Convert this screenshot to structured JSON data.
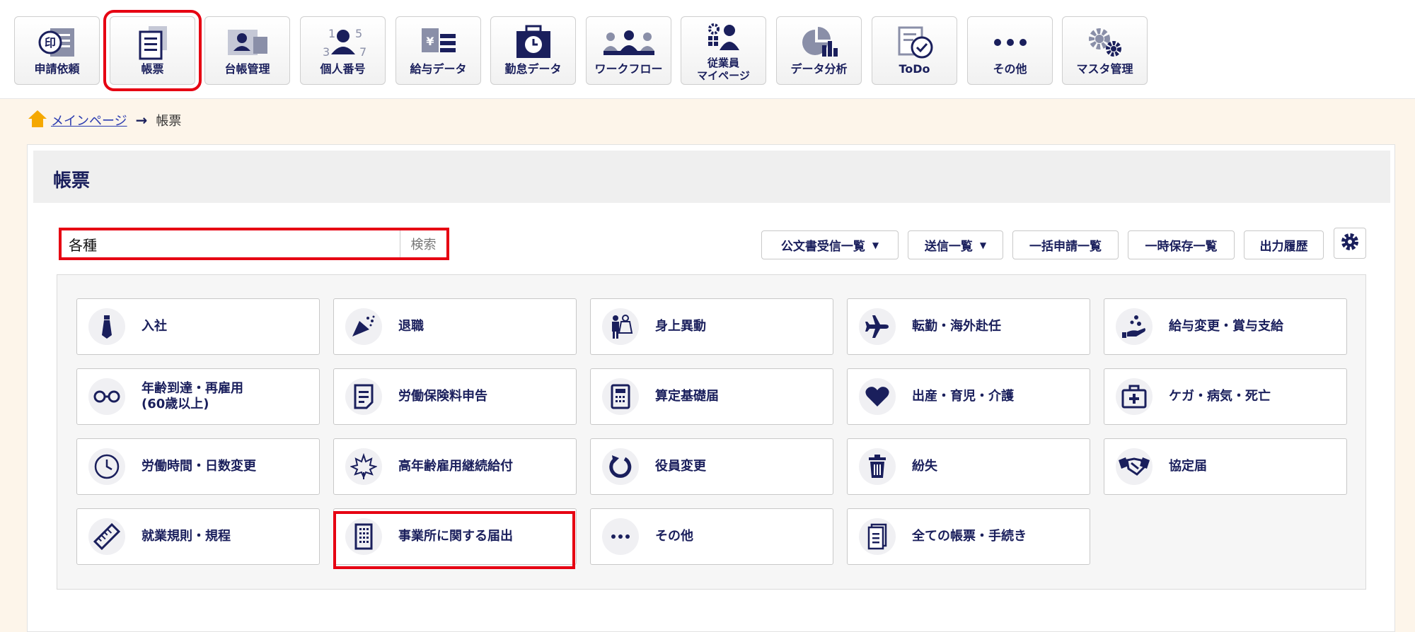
{
  "nav": [
    {
      "label": "申請依頼"
    },
    {
      "label": "帳票"
    },
    {
      "label": "台帳管理"
    },
    {
      "label": "個人番号"
    },
    {
      "label": "給与データ"
    },
    {
      "label": "勤怠データ"
    },
    {
      "label": "ワークフロー"
    },
    {
      "label": "従業員",
      "label2": "マイページ"
    },
    {
      "label": "データ分析"
    },
    {
      "label": "ToDo"
    },
    {
      "label": "その他"
    },
    {
      "label": "マスタ管理"
    }
  ],
  "breadcrumb": {
    "home": "メインページ",
    "current": "帳票"
  },
  "page_title": "帳票",
  "search": {
    "value": "各種",
    "button": "検索"
  },
  "toolbar": {
    "official_docs": "公文書受信一覧",
    "sent_list": "送信一覧",
    "bulk_apply": "一括申請一覧",
    "temp_saved": "一時保存一覧",
    "output_history": "出力履歴"
  },
  "categories": [
    {
      "label": "入社"
    },
    {
      "label": "退職"
    },
    {
      "label": "身上異動"
    },
    {
      "label": "転勤・海外赴任"
    },
    {
      "label": "給与変更・賞与支給"
    },
    {
      "label": "年齢到達・再雇用\n(60歳以上)"
    },
    {
      "label": "労働保険料申告"
    },
    {
      "label": "算定基礎届"
    },
    {
      "label": "出産・育児・介護"
    },
    {
      "label": "ケガ・病気・死亡"
    },
    {
      "label": "労働時間・日数変更"
    },
    {
      "label": "高年齢雇用継続給付"
    },
    {
      "label": "役員変更"
    },
    {
      "label": "紛失"
    },
    {
      "label": "協定届"
    },
    {
      "label": "就業規則・規程"
    },
    {
      "label": "事業所に関する届出"
    },
    {
      "label": "その他"
    },
    {
      "label": "全ての帳票・手続き"
    }
  ],
  "colors": {
    "navy": "#1a1f5c",
    "highlight": "#e60012",
    "bg": "#fdf5ea",
    "link": "#2a3bb0"
  }
}
